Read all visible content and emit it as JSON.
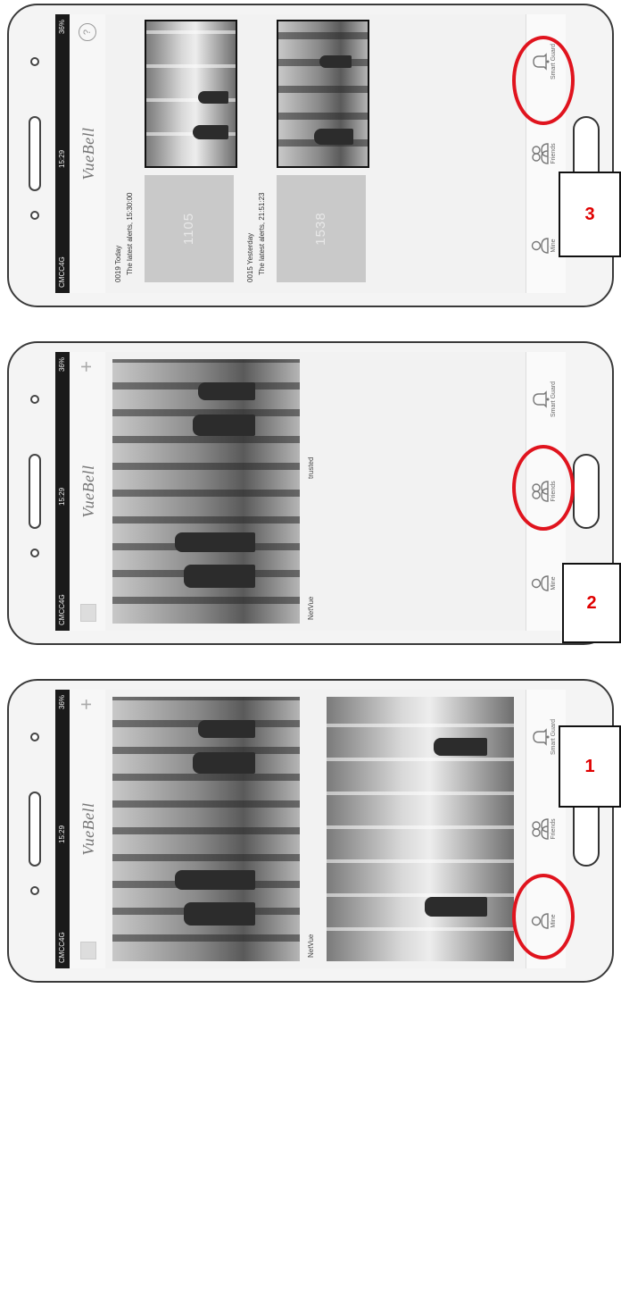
{
  "status_bar": {
    "carrier": "CMCC4G",
    "time": "15:29",
    "battery": "36%"
  },
  "app": {
    "logo": "VueBell"
  },
  "tabs": [
    {
      "label": "Mine"
    },
    {
      "label": "Friends"
    },
    {
      "label": "Smart Guard"
    }
  ],
  "phone1": {
    "camera_name": "NetVue",
    "callout": "1"
  },
  "phone2": {
    "camera_name": "NetVue",
    "camera_status": "trusted",
    "callout": "2"
  },
  "phone3": {
    "help_icon": "?",
    "alerts": [
      {
        "title": "0019 Today",
        "latest": "The latest alerts, 15:30:00",
        "count": "1105"
      },
      {
        "title": "0015 Yesterday",
        "latest": "The latest alerts, 21:51:23",
        "count": "1538"
      }
    ],
    "callout": "3"
  },
  "colors": {
    "highlight_ring": "#e0141e",
    "callout_number": "#e00000"
  }
}
